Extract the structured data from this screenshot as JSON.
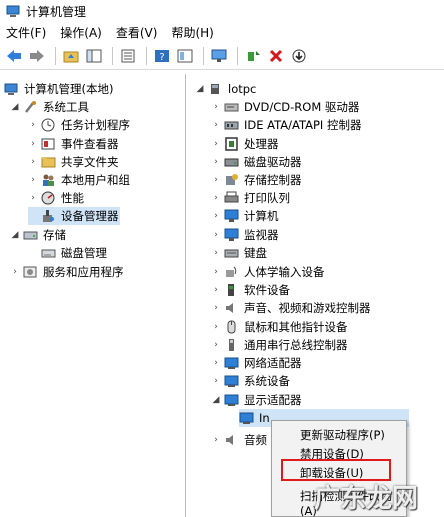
{
  "window": {
    "title": "计算机管理"
  },
  "menu": [
    "文件(F)",
    "操作(A)",
    "查看(V)",
    "帮助(H)"
  ],
  "colors": {
    "selection": "#cfe4f7",
    "highlight_border": "#e0191b",
    "folder": "#e8c15a",
    "monitor": "#2e7fd6"
  },
  "left_tree": {
    "root": "计算机管理(本地)",
    "system_tools": "系统工具",
    "system_items": [
      "任务计划程序",
      "事件查看器",
      "共享文件夹",
      "本地用户和组",
      "性能",
      "设备管理器"
    ],
    "storage": "存储",
    "storage_items": [
      "磁盘管理"
    ],
    "services": "服务和应用程序"
  },
  "right_tree": {
    "root": "lotpc",
    "devices": [
      "DVD/CD-ROM 驱动器",
      "IDE ATA/ATAPI 控制器",
      "处理器",
      "磁盘驱动器",
      "存储控制器",
      "打印队列",
      "计算机",
      "监视器",
      "键盘",
      "人体学输入设备",
      "软件设备",
      "声音、视频和游戏控制器",
      "鼠标和其他指针设备",
      "通用串行总线控制器",
      "网络适配器",
      "系统设备",
      "显示适配器"
    ],
    "child_partial": "In",
    "next_partial": "音频"
  },
  "context_menu": [
    "更新驱动程序(P)",
    "禁用设备(D)",
    "卸载设备(U)",
    "扫描检测硬件改动(A)"
  ],
  "watermark": "广东龙网"
}
